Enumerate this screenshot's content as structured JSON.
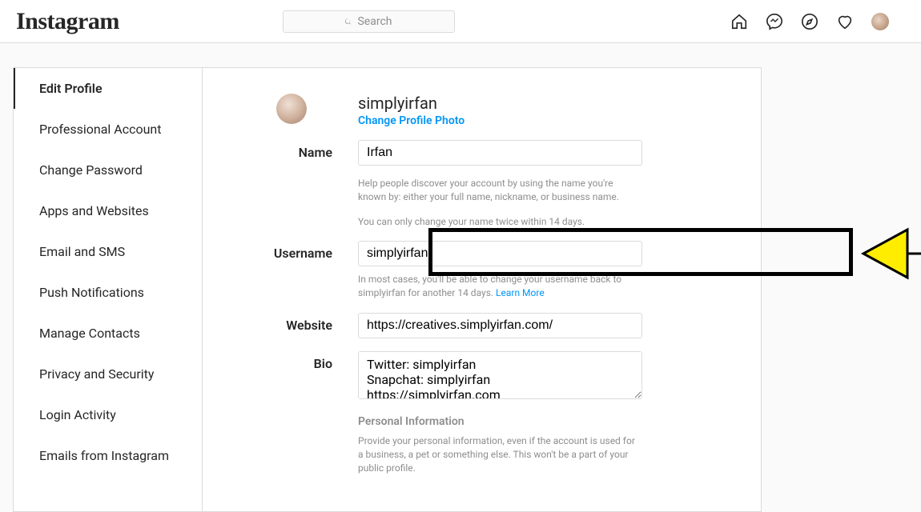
{
  "brand": "Instagram",
  "search": {
    "placeholder": "Search"
  },
  "sidebar": {
    "items": [
      "Edit Profile",
      "Professional Account",
      "Change Password",
      "Apps and Websites",
      "Email and SMS",
      "Push Notifications",
      "Manage Contacts",
      "Privacy and Security",
      "Login Activity",
      "Emails from Instagram"
    ]
  },
  "profile": {
    "username_display": "simplyirfan",
    "change_photo_label": "Change Profile Photo",
    "labels": {
      "name": "Name",
      "username": "Username",
      "website": "Website",
      "bio": "Bio"
    },
    "name_value": "Irfan",
    "name_help1": "Help people discover your account by using the name you're known by: either your full name, nickname, or business name.",
    "name_help2": "You can only change your name twice within 14 days.",
    "username_value": "simplyirfan",
    "username_help_pre": "In most cases, you'll be able to change your username back to simplyirfan for another 14 days. ",
    "username_help_link": "Learn More",
    "website_value": "https://creatives.simplyirfan.com/",
    "bio_value": "Twitter: simplyirfan\nSnapchat: simplyirfan\nhttps://simplyirfan.com",
    "personal_info_heading": "Personal Information",
    "personal_info_help": "Provide your personal information, even if the account is used for a business, a pet or something else. This won't be a part of your public profile."
  }
}
